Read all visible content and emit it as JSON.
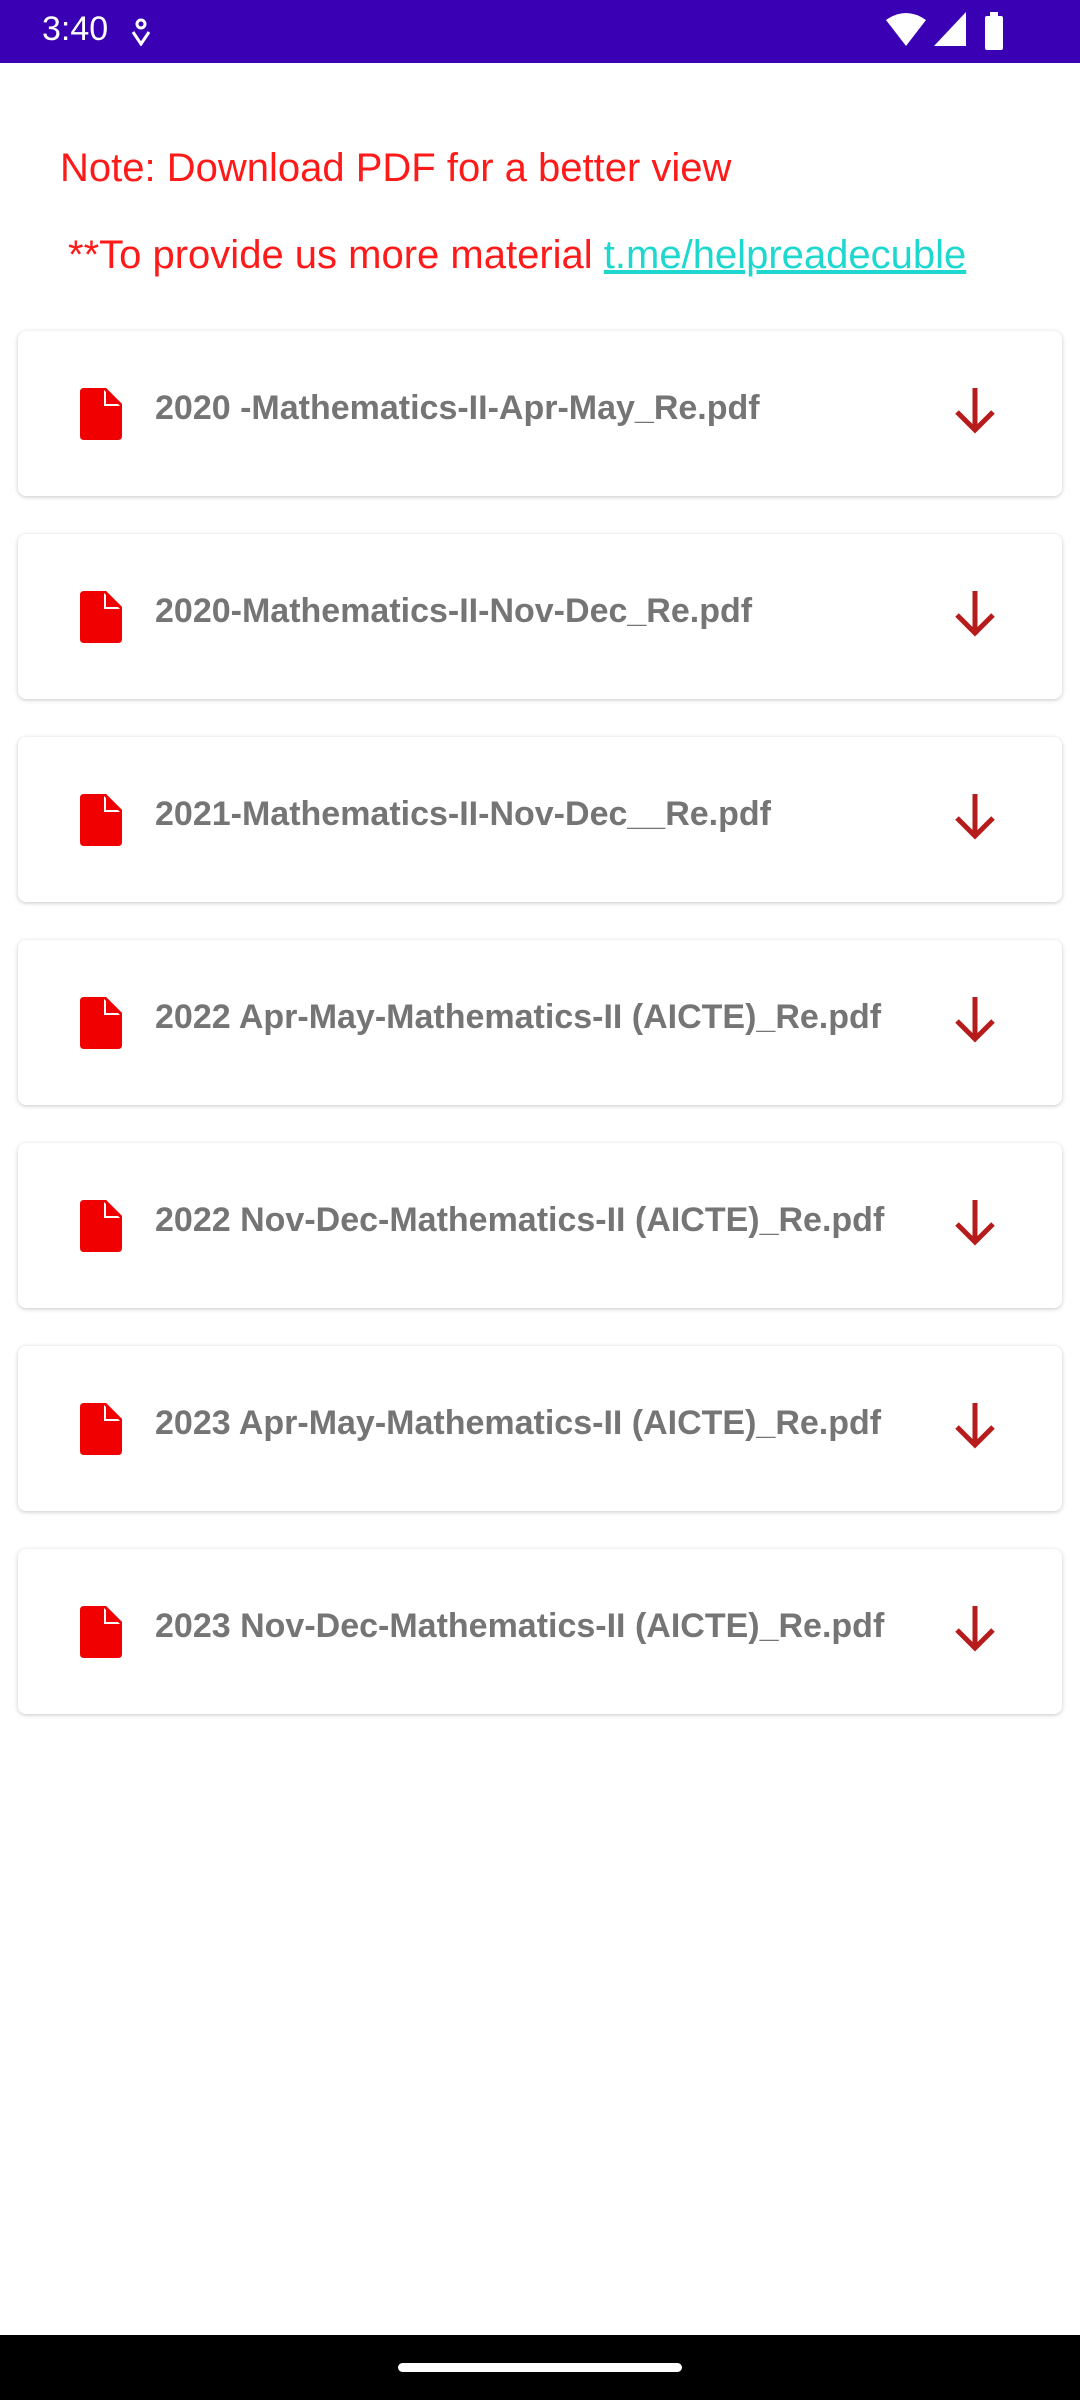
{
  "status_bar": {
    "time": "3:40"
  },
  "note": "Note: Download PDF for a better view",
  "more_material": {
    "text": "**To provide us more material ",
    "link": "t.me/helpreadecuble"
  },
  "files": [
    {
      "name": "2020 -Mathematics-II-Apr-May_Re.pdf"
    },
    {
      "name": "2020-Mathematics-II-Nov-Dec_Re.pdf"
    },
    {
      "name": "2021-Mathematics-II-Nov-Dec__Re.pdf"
    },
    {
      "name": "2022 Apr-May-Mathematics-II (AICTE)_Re.pdf"
    },
    {
      "name": "2022 Nov-Dec-Mathematics-II (AICTE)_Re.pdf"
    },
    {
      "name": "2023 Apr-May-Mathematics-II (AICTE)_Re.pdf"
    },
    {
      "name": "2023 Nov-Dec-Mathematics-II (AICTE)_Re.pdf"
    }
  ],
  "colors": {
    "status_bar": "#3a00b4",
    "note": "#ff1a1a",
    "link": "#1ed8d0",
    "file_icon": "#f00000",
    "download_icon": "#b71c1c"
  }
}
